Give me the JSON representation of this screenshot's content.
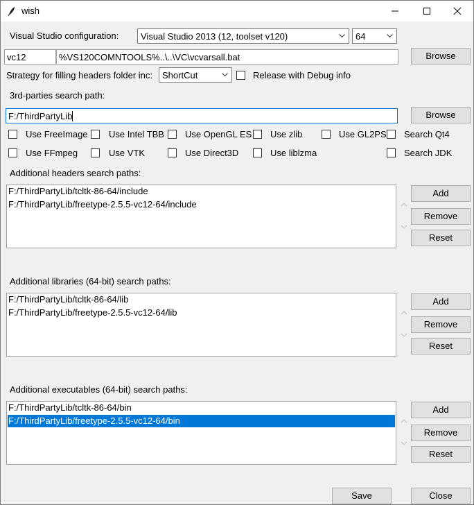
{
  "window": {
    "title": "wish"
  },
  "vs_config": {
    "label": "Visual Studio configuration:",
    "selected": "Visual Studio 2013 (12, toolset v120)",
    "arch": "64"
  },
  "env": {
    "vc": "vc12",
    "vcvars": "%VS120COMNTOOLS%..\\..\\VC\\vcvarsall.bat",
    "browse": "Browse"
  },
  "strategy": {
    "label": "Strategy for filling headers folder inc:",
    "selected": "ShortCut",
    "release_debug": "Release with Debug info"
  },
  "third_party": {
    "label": "3rd-parties search path:",
    "value": "F:/ThirdPartyLib",
    "browse": "Browse"
  },
  "options_row1": [
    "Use FreeImage",
    "Use Intel TBB",
    "Use OpenGL ES",
    "Use zlib",
    "Use GL2PS",
    "Search Qt4"
  ],
  "options_row2": [
    "Use FFmpeg",
    "Use VTK",
    "Use Direct3D",
    "Use liblzma",
    "Search JDK"
  ],
  "headers": {
    "label": "Additional headers search paths:",
    "items": [
      "F:/ThirdPartyLib/tcltk-86-64/include",
      "F:/ThirdPartyLib/freetype-2.5.5-vc12-64/include"
    ]
  },
  "libraries": {
    "label": "Additional libraries (64-bit) search paths:",
    "items": [
      "F:/ThirdPartyLib/tcltk-86-64/lib",
      "F:/ThirdPartyLib/freetype-2.5.5-vc12-64/lib"
    ]
  },
  "executables": {
    "label": "Additional executables (64-bit) search paths:",
    "items": [
      "F:/ThirdPartyLib/tcltk-86-64/bin",
      "F:/ThirdPartyLib/freetype-2.5.5-vc12-64/bin"
    ]
  },
  "list_buttons": {
    "add": "Add",
    "remove": "Remove",
    "reset": "Reset"
  },
  "footer": {
    "save": "Save",
    "close": "Close"
  }
}
